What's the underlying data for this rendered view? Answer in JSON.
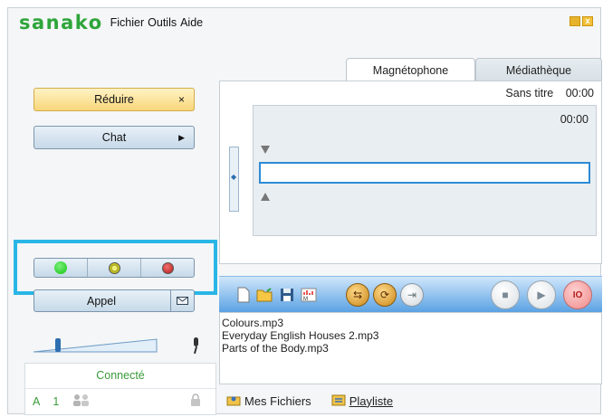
{
  "app": {
    "logo": "sanako",
    "menu": [
      "Fichier",
      "Outils",
      "Aide"
    ],
    "close_symbol": "x"
  },
  "left": {
    "reduire_label": "Réduire",
    "reduire_glyph": "×",
    "chat_label": "Chat",
    "chat_glyph": "▶",
    "status_dots": [
      {
        "icon": "green-status-dot",
        "color": "#11c411"
      },
      {
        "icon": "yellow-status-dot",
        "color": "#c8c820"
      },
      {
        "icon": "red-status-dot",
        "color": "#b41a1a"
      }
    ],
    "appel_label": "Appel",
    "appel_icon": "envelope-icon",
    "volume_level": 0.2
  },
  "connection": {
    "status": "Connecté",
    "letter": "A",
    "number": "1"
  },
  "tabs": [
    {
      "label": "Magnétophone",
      "active": true
    },
    {
      "label": "Médiathèque",
      "active": false
    }
  ],
  "recorder": {
    "title": "Sans titre",
    "time": "00:00",
    "track_time": "00:00"
  },
  "toolbar": {
    "buttons": [
      "new-file-icon",
      "open-folder-icon",
      "save-icon",
      "audio-marker-icon",
      "shuffle-icon",
      "repeat-icon",
      "export-icon",
      "stop-icon",
      "play-icon",
      "record-icon"
    ],
    "record_label": "IO"
  },
  "files": [
    "Colours.mp3",
    "Everyday English Houses 2.mp3",
    "Parts of the Body.mp3"
  ],
  "bottom_tabs": [
    "Mes Fichiers",
    "Playliste"
  ]
}
